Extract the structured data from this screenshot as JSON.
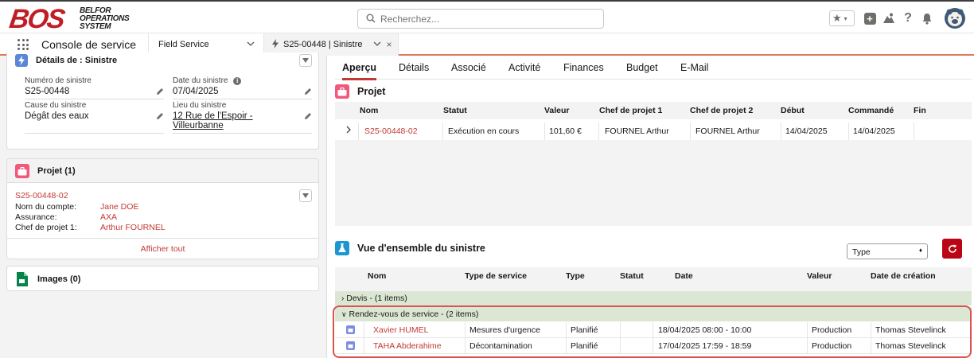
{
  "topbar": {
    "logo_main": "BOS",
    "logo_sub": [
      "BELFOR",
      "OPERATIONS",
      "SYSTEM"
    ],
    "search_placeholder": "Recherchez..."
  },
  "navbar": {
    "app_name": "Console de service",
    "tabs": [
      {
        "label": "Field Service"
      },
      {
        "label": "S25-00448 | Sinistre"
      }
    ]
  },
  "details_card": {
    "title": "Détails de : Sinistre",
    "fields": {
      "numero_label": "Numéro de sinistre",
      "numero_value": "S25-00448",
      "date_label": "Date du sinistre",
      "date_value": "07/04/2025",
      "cause_label": "Cause du sinistre",
      "cause_value": "Dégât des eaux",
      "lieu_label": "Lieu du sinistre",
      "lieu_line1": "12 Rue de l'Espoir -",
      "lieu_line2": "Villeurbanne"
    }
  },
  "projet_card": {
    "title": "Projet (1)",
    "record_link": "S25-00448-02",
    "rows": [
      {
        "key": "Nom du compte:",
        "value": "Jane DOE"
      },
      {
        "key": "Assurance:",
        "value": "AXA"
      },
      {
        "key": "Chef de projet 1:",
        "value": "Arthur FOURNEL"
      }
    ],
    "show_all": "Afficher tout"
  },
  "images_card": {
    "title": "Images (0)"
  },
  "main_tabs": [
    "Aperçu",
    "Détails",
    "Associé",
    "Activité",
    "Finances",
    "Budget",
    "E-Mail"
  ],
  "projet_section": {
    "title": "Projet",
    "headers": [
      "Nom",
      "Statut",
      "Valeur",
      "Chef de projet 1",
      "Chef de projet 2",
      "Début",
      "Commandé",
      "Fin"
    ],
    "row": {
      "nom": "S25-00448-02",
      "statut": "Exécution en cours",
      "valeur": "101,60 €",
      "chef1": "FOURNEL Arthur",
      "chef2": "FOURNEL Arthur",
      "debut": "14/04/2025",
      "commande": "14/04/2025",
      "fin": ""
    }
  },
  "overview_section": {
    "title": "Vue d'ensemble du sinistre",
    "type_select": "Type",
    "headers": [
      "Nom",
      "Type de service",
      "Type",
      "Statut",
      "Date",
      "Valeur",
      "Date de création"
    ],
    "group_devis": "Devis - (1 items)",
    "group_rdv": "Rendez-vous de service - (2 items)",
    "rdv_rows": [
      {
        "nom": "Xavier HUMEL",
        "service": "Mesures d'urgence",
        "type": "Planifié",
        "statut": "",
        "date": "18/04/2025 08:00 - 10:00",
        "valeur": "Production",
        "creation": "Thomas Stevelinck"
      },
      {
        "nom": "TAHA Abderahime",
        "service": "Décontamination",
        "type": "Planifié",
        "statut": "",
        "date": "17/04/2025 17:59 - 18:59",
        "valeur": "Production",
        "creation": "Thomas Stevelinck"
      }
    ]
  },
  "colors": {
    "accent": "#c23934",
    "tab_underline": "#e07a5f",
    "highlight": "#d9534f",
    "group_green": "#dbe7d3"
  }
}
